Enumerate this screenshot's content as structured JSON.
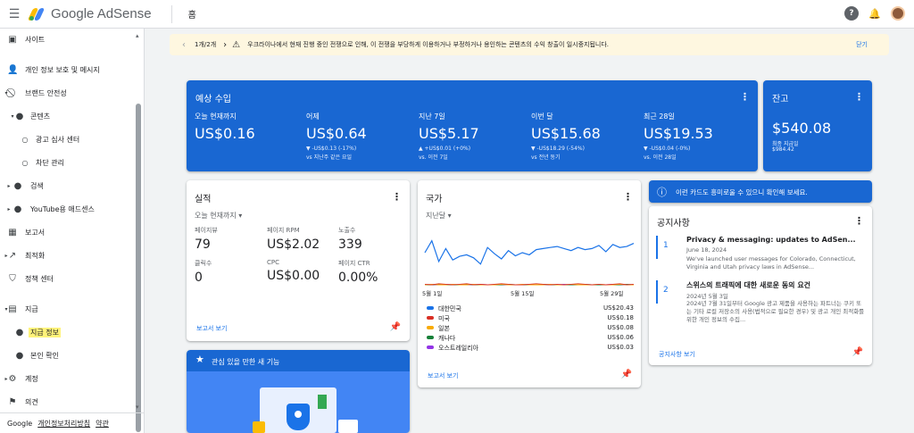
{
  "app": {
    "name": "Google AdSense",
    "breadcrumb": "홈"
  },
  "colors": {
    "blue": "#1967d2",
    "highlight": "#fff37a",
    "green": "#188038",
    "red": "#d93025",
    "yellow": "#f9ab00",
    "purple": "#9334e6"
  },
  "sidebar": {
    "items": [
      {
        "label": "사이트",
        "icon": "browser-icon"
      },
      {
        "label": "개인 정보 보호 및 메시지",
        "icon": "person-lock-icon"
      },
      {
        "label": "브랜드 안전성",
        "icon": "block-icon"
      },
      {
        "label": "콘텐츠",
        "icon": "bullet-icon"
      },
      {
        "label": "광고 심사 센터",
        "icon": "circle-icon"
      },
      {
        "label": "차단 관리",
        "icon": "circle-icon"
      },
      {
        "label": "검색",
        "icon": "bullet-icon"
      },
      {
        "label": "YouTube용 애드센스",
        "icon": "bullet-icon"
      },
      {
        "label": "보고서",
        "icon": "chart-icon"
      },
      {
        "label": "최적화",
        "icon": "trending-icon"
      },
      {
        "label": "정책 센터",
        "icon": "shield-icon"
      },
      {
        "label": "지급",
        "icon": "payments-icon"
      },
      {
        "label": "지급 정보",
        "icon": "bullet-icon"
      },
      {
        "label": "본인 확인",
        "icon": "bullet-icon"
      },
      {
        "label": "계정",
        "icon": "gear-icon"
      },
      {
        "label": "의견",
        "icon": "feedback-icon"
      }
    ],
    "footer": {
      "brand": "Google",
      "privacy": "개인정보처리방침",
      "terms": "약관"
    }
  },
  "alert": {
    "pager": "1개/2개",
    "message": "우크라이나에서 현재 진행 중인 전쟁으로 인해, 이 전쟁을 부당하게 이용하거나 부정하거나 용인하는 콘텐츠의 수익 창출이 일시중지됩니다.",
    "close": "닫기"
  },
  "earnings": {
    "title": "예상 수입",
    "cols": [
      {
        "label": "오늘 현재까지",
        "value": "US$0.16",
        "d1": "",
        "d2": ""
      },
      {
        "label": "어제",
        "value": "US$0.64",
        "d1": "▼ -US$0.13 (-17%)",
        "d2": "vs 지난주 같은 요일"
      },
      {
        "label": "지난 7일",
        "value": "US$5.17",
        "d1": "▲ +US$0.01 (+0%)",
        "d2": "vs. 이전 7일"
      },
      {
        "label": "이번 달",
        "value": "US$15.68",
        "d1": "▼ -US$18.29 (-54%)",
        "d2": "vs 전년 동기"
      },
      {
        "label": "최근 28일",
        "value": "US$19.53",
        "d1": "▼ -US$0.04 (-0%)",
        "d2": "vs. 이전 28일"
      }
    ]
  },
  "balance": {
    "title": "잔고",
    "value": "$540.08",
    "sub_label": "최종 지급일",
    "sub_value": "$984.42"
  },
  "performance": {
    "title": "실적",
    "range": "오늘 현재까지",
    "metrics": [
      {
        "label": "페이지뷰",
        "value": "79"
      },
      {
        "label": "페이지 RPM",
        "value": "US$2.02"
      },
      {
        "label": "노출수",
        "value": "339"
      },
      {
        "label": "클릭수",
        "value": "0"
      },
      {
        "label": "CPC",
        "value": "US$0.00"
      },
      {
        "label": "페이지 CTR",
        "value": "0.00%"
      }
    ],
    "link": "보고서 보기"
  },
  "features": {
    "title": "관심 있을 만한 새 기능"
  },
  "countries": {
    "title": "국가",
    "range": "지난달",
    "ticks": [
      "5월 1일",
      "5월 15일",
      "5월 29일"
    ],
    "rows": [
      {
        "name": "대한민국",
        "amount": "US$20.43",
        "color": "#1a73e8"
      },
      {
        "name": "미국",
        "amount": "US$0.18",
        "color": "#d93025"
      },
      {
        "name": "일본",
        "amount": "US$0.08",
        "color": "#f9ab00"
      },
      {
        "name": "캐나다",
        "amount": "US$0.06",
        "color": "#188038"
      },
      {
        "name": "오스트레일리아",
        "amount": "US$0.03",
        "color": "#9334e6"
      }
    ],
    "link": "보고서 보기"
  },
  "chart_data": {
    "type": "line",
    "xlabel": "",
    "ylabel": "",
    "x_ticks": [
      "5월 1일",
      "5월 15일",
      "5월 29일"
    ],
    "series": [
      {
        "name": "대한민국",
        "color": "#1a73e8",
        "values": [
          0.62,
          0.85,
          0.45,
          0.7,
          0.48,
          0.55,
          0.58,
          0.52,
          0.4,
          0.72,
          0.6,
          0.5,
          0.66,
          0.56,
          0.62,
          0.58,
          0.68,
          0.7,
          0.72,
          0.74,
          0.7,
          0.66,
          0.72,
          0.68,
          0.7,
          0.76,
          0.64,
          0.78,
          0.72,
          0.74,
          0.8
        ]
      },
      {
        "name": "미국",
        "color": "#d93025",
        "values": [
          0.01,
          0.0,
          0.02,
          0.01,
          0.0,
          0.01,
          0.02,
          0.0,
          0.01,
          0.0,
          0.01,
          0.02,
          0.01,
          0.0,
          0.0,
          0.01,
          0.02,
          0.01,
          0.0,
          0.01,
          0.0,
          0.01,
          0.02,
          0.01,
          0.0,
          0.01,
          0.0,
          0.01,
          0.02,
          0.0,
          0.01
        ]
      },
      {
        "name": "일본",
        "color": "#f9ab00",
        "values": [
          0.0,
          0.01,
          0.0,
          0.0,
          0.01,
          0.0,
          0.0,
          0.01,
          0.0,
          0.0,
          0.0,
          0.01,
          0.0,
          0.0,
          0.01,
          0.0,
          0.0,
          0.0,
          0.01,
          0.0,
          0.0,
          0.01,
          0.0,
          0.0,
          0.0,
          0.01,
          0.0,
          0.0,
          0.01,
          0.0,
          0.0
        ]
      },
      {
        "name": "캐나다",
        "color": "#188038",
        "values": [
          0,
          0,
          0.01,
          0,
          0,
          0,
          0.01,
          0,
          0,
          0,
          0,
          0,
          0.01,
          0,
          0,
          0,
          0,
          0.01,
          0,
          0,
          0,
          0,
          0,
          0.01,
          0,
          0,
          0,
          0,
          0,
          0.01,
          0
        ]
      },
      {
        "name": "오스트레일리아",
        "color": "#9334e6",
        "values": [
          0,
          0,
          0,
          0.01,
          0,
          0,
          0,
          0,
          0.01,
          0,
          0,
          0,
          0,
          0,
          0,
          0.01,
          0,
          0,
          0,
          0,
          0.01,
          0,
          0,
          0,
          0,
          0,
          0,
          0.01,
          0,
          0,
          0
        ]
      }
    ]
  },
  "promo": {
    "text": "이런 카드도 흥미로울 수 있으니 확인해 보세요."
  },
  "notices": {
    "title": "공지사항",
    "items": [
      {
        "num": "1",
        "title": "Privacy & messaging: updates to AdSen...",
        "date": "June 18, 2024",
        "body": "We've launched user messages for Colorado, Connecticut, Virginia and Utah privacy laws in AdSense..."
      },
      {
        "num": "2",
        "title": "스위스의 트래픽에 대한 새로운 동의 요건",
        "date": "2024년 5월 3일",
        "body": "2024년 7월 31일부터 Google 광고 제품을 사용하는 파트너는 쿠키 또는 기타 로컬 저장소의 사용(법적으로 필요한 경우) 및 광고 개인 최적화를 위한 개인 정보의 수집..."
      }
    ],
    "link": "공지사항 보기"
  }
}
